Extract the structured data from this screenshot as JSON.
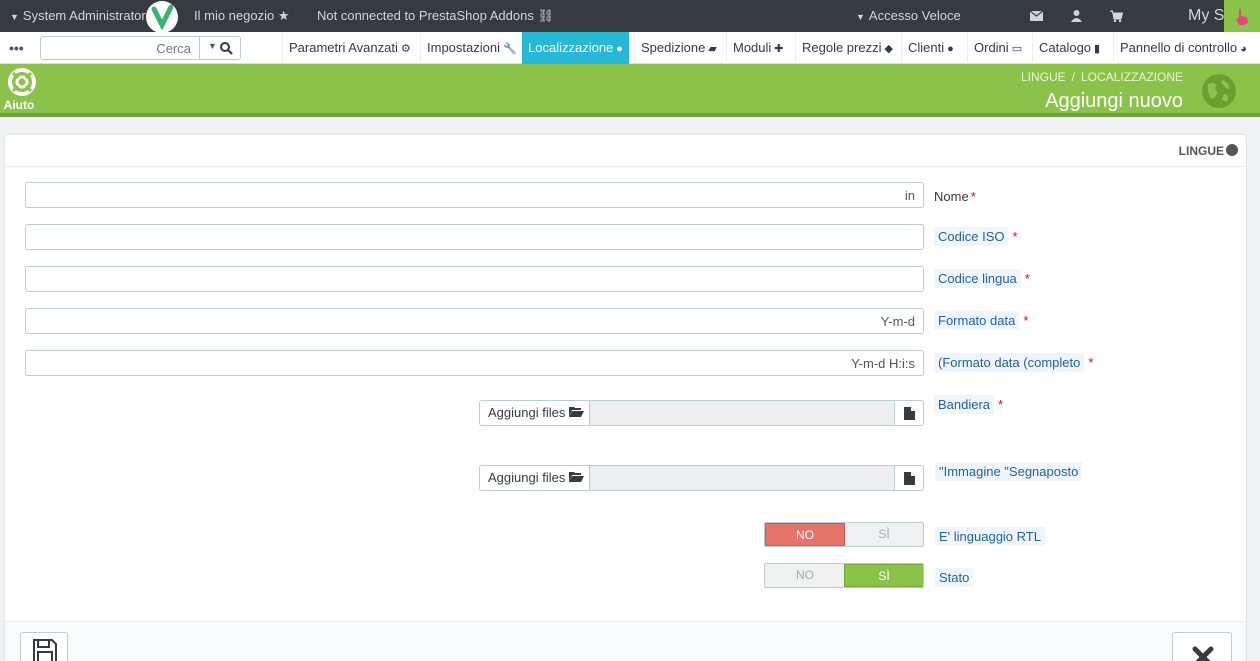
{
  "topbar": {
    "admin_label": "System Administrator",
    "shop_label": "Il mio negozio",
    "addons_label": "Not connected to PrestaShop Addons",
    "quick_access_label": "Accesso Veloce",
    "my_store_label": "My S"
  },
  "nav": {
    "dots": "•••",
    "search_placeholder": "Cerca",
    "items": [
      {
        "label": "Parametri Avanzati",
        "icon": "cogs-icon"
      },
      {
        "label": "Impostazioni",
        "icon": "wrench-icon"
      },
      {
        "label": "Localizzazione",
        "icon": "globe-icon"
      },
      {
        "label": "Spedizione",
        "icon": "truck-icon"
      },
      {
        "label": "Moduli",
        "icon": "puzzle-icon"
      },
      {
        "label": "Regole prezzi",
        "icon": "tags-icon"
      },
      {
        "label": "Clienti",
        "icon": "users-icon"
      },
      {
        "label": "Ordini",
        "icon": "credit-card-icon"
      },
      {
        "label": "Catalogo",
        "icon": "book-icon"
      },
      {
        "label": "Pannello di controllo",
        "icon": "dashboard-icon"
      }
    ]
  },
  "header": {
    "help_label": "Aiuto",
    "breadcrumb_1": "LINGUE",
    "breadcrumb_sep": "/",
    "breadcrumb_2": "LOCALIZZAZIONE",
    "title": "Aggiungi nuovo"
  },
  "panel": {
    "heading": "LINGUE"
  },
  "form": {
    "name_value": "in",
    "name_label": "Nome",
    "iso_label": "Codice ISO",
    "lang_code_label": "Codice lingua",
    "date_format_value": "Y-m-d",
    "date_format_label": "Formato data",
    "date_full_value": "Y-m-d H:i:s",
    "date_full_label": "(Formato data (completo",
    "flag_label": "Bandiera",
    "placeholder_img_label": "\"Immagine \"Segnaposto",
    "add_files_label": "Aggiungi files",
    "rtl_label": "E' linguaggio RTL",
    "status_label": "Stato",
    "no_label": "NO",
    "yes_label": "SÌ",
    "required_mark": "*"
  },
  "colors": {
    "header_green": "#8bc34a",
    "active_blue": "#25b9d7",
    "topbar": "#363a41",
    "switch_no": "#e6726c"
  }
}
